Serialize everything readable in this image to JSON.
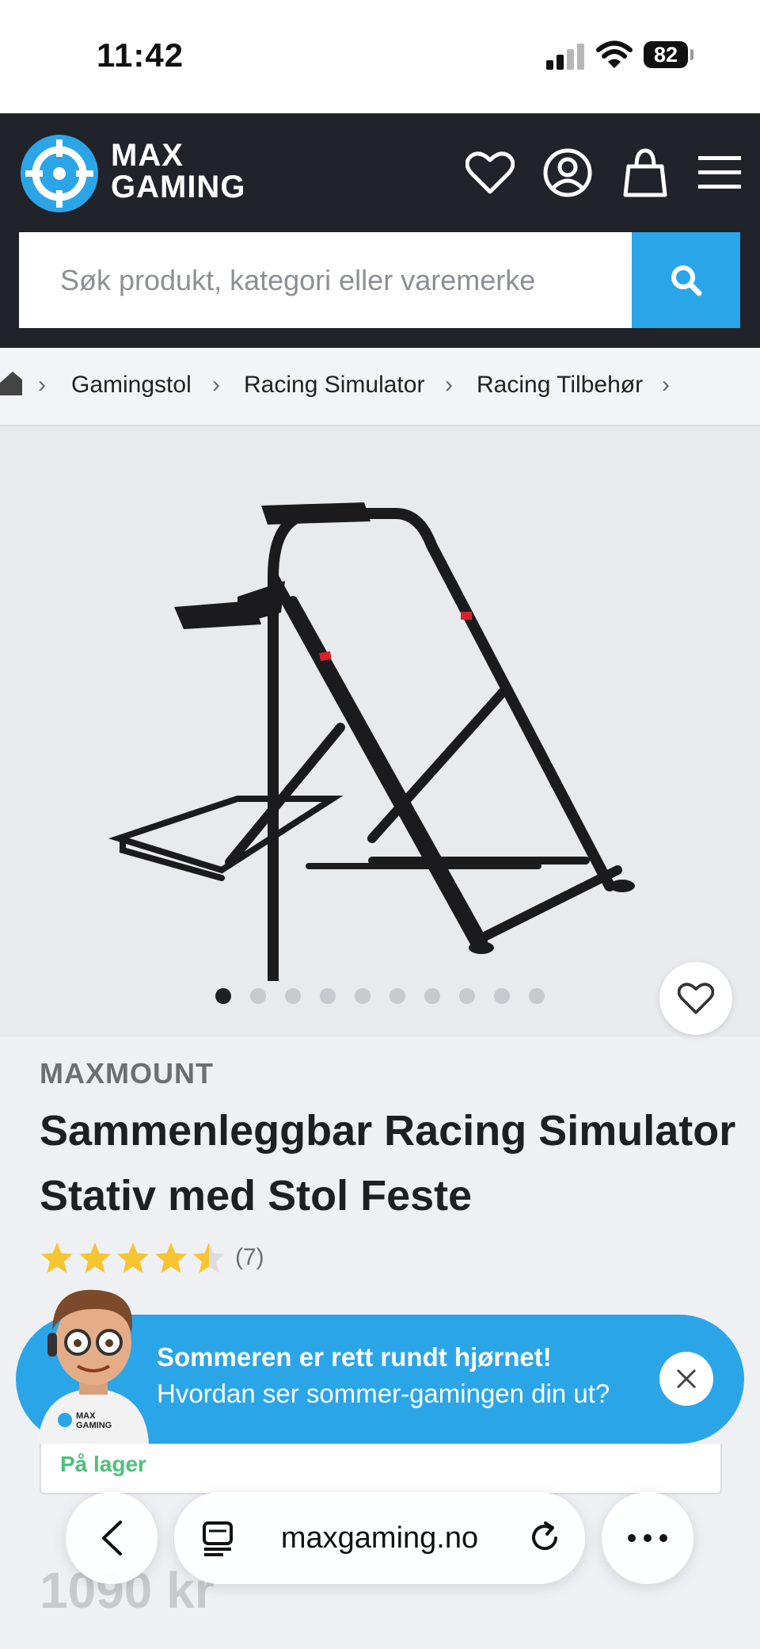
{
  "status_bar": {
    "time": "11:42",
    "battery": "82"
  },
  "header": {
    "brand_line1": "MAX",
    "brand_line2": "GAMING",
    "icons": [
      "heart-icon",
      "user-icon",
      "bag-icon",
      "menu-icon"
    ],
    "accent": "#2aa6e8",
    "background": "#21232b"
  },
  "search": {
    "placeholder": "Søk produkt, kategori eller varemerke"
  },
  "breadcrumb": [
    "Gamingstol",
    "Racing Simulator",
    "Racing Tilbehør"
  ],
  "gallery": {
    "image_count": 10,
    "active_index": 0
  },
  "product": {
    "brand": "MAXMOUNT",
    "title": "Sammenleggbar Racing Simulator Stativ med Stol Feste",
    "rating": 4.5,
    "rating_count": "(7)",
    "stock": "På lager",
    "price": "1090 kr"
  },
  "promo": {
    "mascot_text_1": "MAX",
    "mascot_text_2": "GAMING",
    "line1": "Sommeren er rett rundt hjørnet!",
    "line2": "Hvordan ser sommer-gamingen din ut?"
  },
  "browser": {
    "url": "maxgaming.no"
  }
}
